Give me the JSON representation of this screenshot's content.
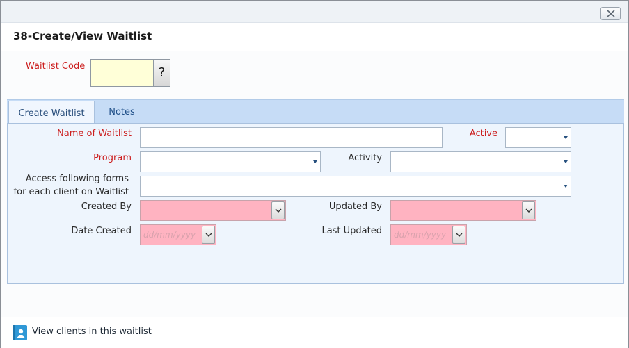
{
  "window": {
    "title": "38-Create/View Waitlist"
  },
  "code": {
    "label": "Waitlist Code",
    "value": "",
    "help_label": "?"
  },
  "tabs": [
    {
      "label": "Create Waitlist",
      "active": true
    },
    {
      "label": "Notes",
      "active": false
    }
  ],
  "form": {
    "name_label": "Name of Waitlist",
    "name_value": "",
    "active_label": "Active",
    "active_value": "",
    "program_label": "Program",
    "program_value": "",
    "activity_label": "Activity",
    "activity_value": "",
    "access_label_line1": "Access following forms",
    "access_label_line2": "for each client on Waitlist",
    "access_value": "",
    "created_by_label": "Created By",
    "created_by_value": "",
    "updated_by_label": "Updated By",
    "updated_by_value": "",
    "date_created_label": "Date Created",
    "date_created_placeholder": "dd/mm/yyyy",
    "last_updated_label": "Last Updated",
    "last_updated_placeholder": "dd/mm/yyyy"
  },
  "footer": {
    "view_clients_label": "View clients in this waitlist"
  },
  "colors": {
    "required": "#cc1f1f",
    "tab_bar": "#c6dcf6",
    "readonly_field": "#ffb3c1",
    "code_field": "#ffffd8"
  }
}
